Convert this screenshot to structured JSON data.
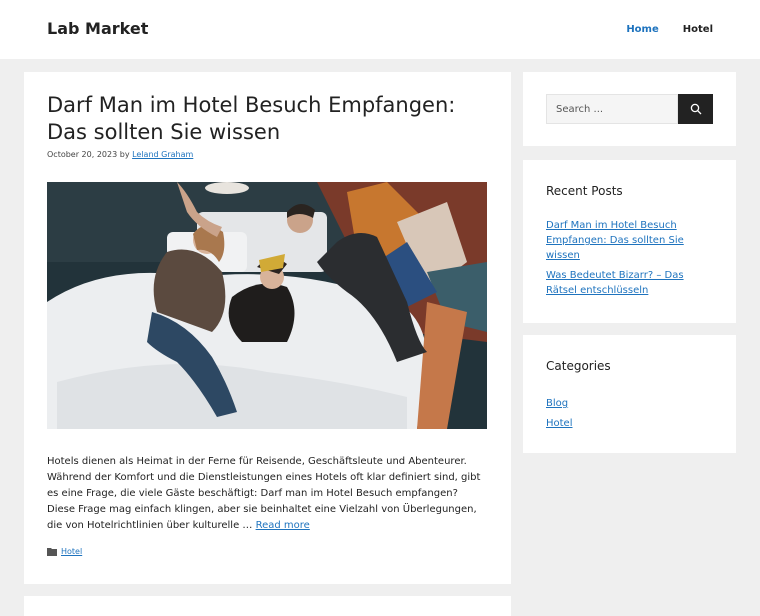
{
  "header": {
    "site_title": "Lab Market",
    "nav": [
      {
        "label": "Home"
      },
      {
        "label": "Hotel"
      }
    ]
  },
  "post": {
    "title": "Darf Man im Hotel Besuch Empfangen: Das sollten Sie wissen",
    "date": "October 20, 2023",
    "by": "by",
    "author": "Leland Graham",
    "excerpt": "Hotels dienen als Heimat in der Ferne für Reisende, Geschäftsleute und Abenteurer. Während der Komfort und die Dienstleistungen eines Hotels oft klar definiert sind, gibt es eine Frage, die viele Gäste beschäftigt: Darf man im Hotel Besuch empfangen? Diese Frage mag einfach klingen, aber sie beinhaltet eine Vielzahl von Überlegungen, die von Hotelrichtlinien über kulturelle …",
    "read_more": "Read more",
    "category": "Hotel"
  },
  "sidebar": {
    "search": {
      "placeholder": "Search ..."
    },
    "recent_posts": {
      "title": "Recent Posts",
      "items": [
        {
          "label": "Darf Man im Hotel Besuch Empfangen: Das sollten Sie wissen"
        },
        {
          "label": "Was Bedeutet Bizarr? – Das Rätsel entschlüsseln"
        }
      ]
    },
    "categories": {
      "title": "Categories",
      "items": [
        {
          "label": "Blog"
        },
        {
          "label": "Hotel"
        }
      ]
    }
  },
  "colors": {
    "accent": "#1e73be",
    "background": "#efefef",
    "search_button": "#222222"
  }
}
